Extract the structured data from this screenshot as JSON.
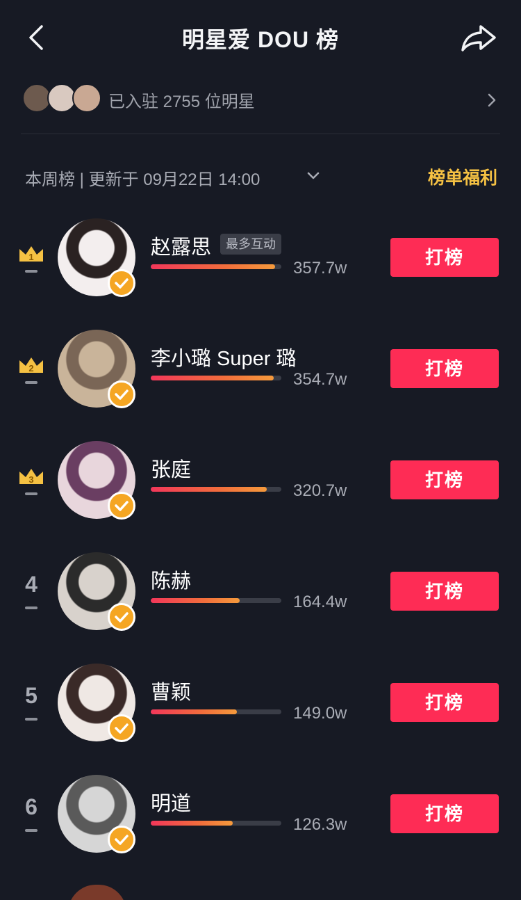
{
  "header": {
    "title": "明星爱 DOU 榜",
    "back_icon": "chevron-left-icon",
    "share_icon": "share-arrow-icon"
  },
  "joined": {
    "text": "已入驻 2755 位明星",
    "chevron_icon": "chevron-right-icon"
  },
  "subheader": {
    "week_text": "本周榜 | 更新于 09月22日 14:00",
    "dropdown_icon": "chevron-down-icon",
    "welfare_label": "榜单福利"
  },
  "vote_label": "打榜",
  "colors": {
    "background": "#171a24",
    "accent": "#fe2c55",
    "gold": "#f5c143",
    "verified": "#f5a623"
  },
  "rankings": [
    {
      "rank": "1",
      "crown": true,
      "name": "赵露思",
      "tag": "最多互动",
      "score": "357.7w",
      "progress": 0.95
    },
    {
      "rank": "2",
      "crown": true,
      "name": "李小璐 Super 璐",
      "tag": "",
      "score": "354.7w",
      "progress": 0.94
    },
    {
      "rank": "3",
      "crown": true,
      "name": "张庭",
      "tag": "",
      "score": "320.7w",
      "progress": 0.89
    },
    {
      "rank": "4",
      "crown": false,
      "name": "陈赫",
      "tag": "",
      "score": "164.4w",
      "progress": 0.68
    },
    {
      "rank": "5",
      "crown": false,
      "name": "曹颖",
      "tag": "",
      "score": "149.0w",
      "progress": 0.66
    },
    {
      "rank": "6",
      "crown": false,
      "name": "明道",
      "tag": "",
      "score": "126.3w",
      "progress": 0.63
    }
  ]
}
